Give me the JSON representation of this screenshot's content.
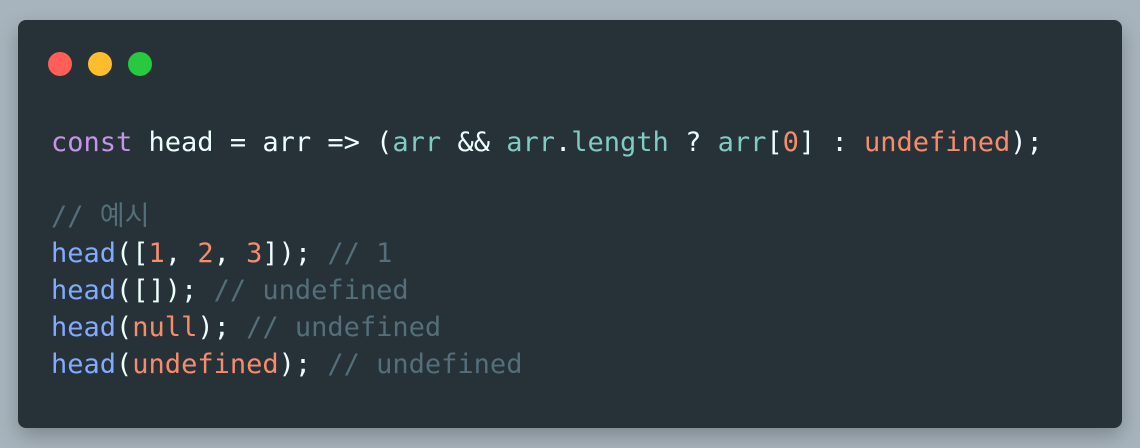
{
  "window": {
    "traffic_lights": [
      {
        "name": "close",
        "color": "#ff5f56"
      },
      {
        "name": "minimize",
        "color": "#ffbd2e"
      },
      {
        "name": "maximize",
        "color": "#27c93f"
      }
    ]
  },
  "code": {
    "line1": {
      "kw_const": "const",
      "name": " head ",
      "eq": "= ",
      "param": "arr ",
      "arrow": "=> ",
      "paren_open": "(",
      "arr1": "arr",
      "and": " && ",
      "arr2": "arr",
      "dot": ".",
      "length": "length",
      "q": " ? ",
      "arr3": "arr",
      "bracket_open": "[",
      "zero": "0",
      "bracket_close": "]",
      "colon": " : ",
      "undef": "undefined",
      "tail": ");"
    },
    "comment_example": "// 예시",
    "examples": [
      {
        "fn": "head",
        "open": "([",
        "args": [
          {
            "v": "1",
            "sep": ", "
          },
          {
            "v": "2",
            "sep": ", "
          },
          {
            "v": "3",
            "sep": ""
          }
        ],
        "close": "]);",
        "comment": " // 1"
      },
      {
        "fn": "head",
        "open": "([",
        "args": [],
        "close": "]);",
        "comment": " // undefined"
      },
      {
        "fn": "head",
        "open": "(",
        "args": [
          {
            "v": "null",
            "sep": ""
          }
        ],
        "close": ");",
        "comment": " // undefined"
      },
      {
        "fn": "head",
        "open": "(",
        "args": [
          {
            "v": "undefined",
            "sep": ""
          }
        ],
        "close": ");",
        "comment": " // undefined"
      }
    ]
  }
}
